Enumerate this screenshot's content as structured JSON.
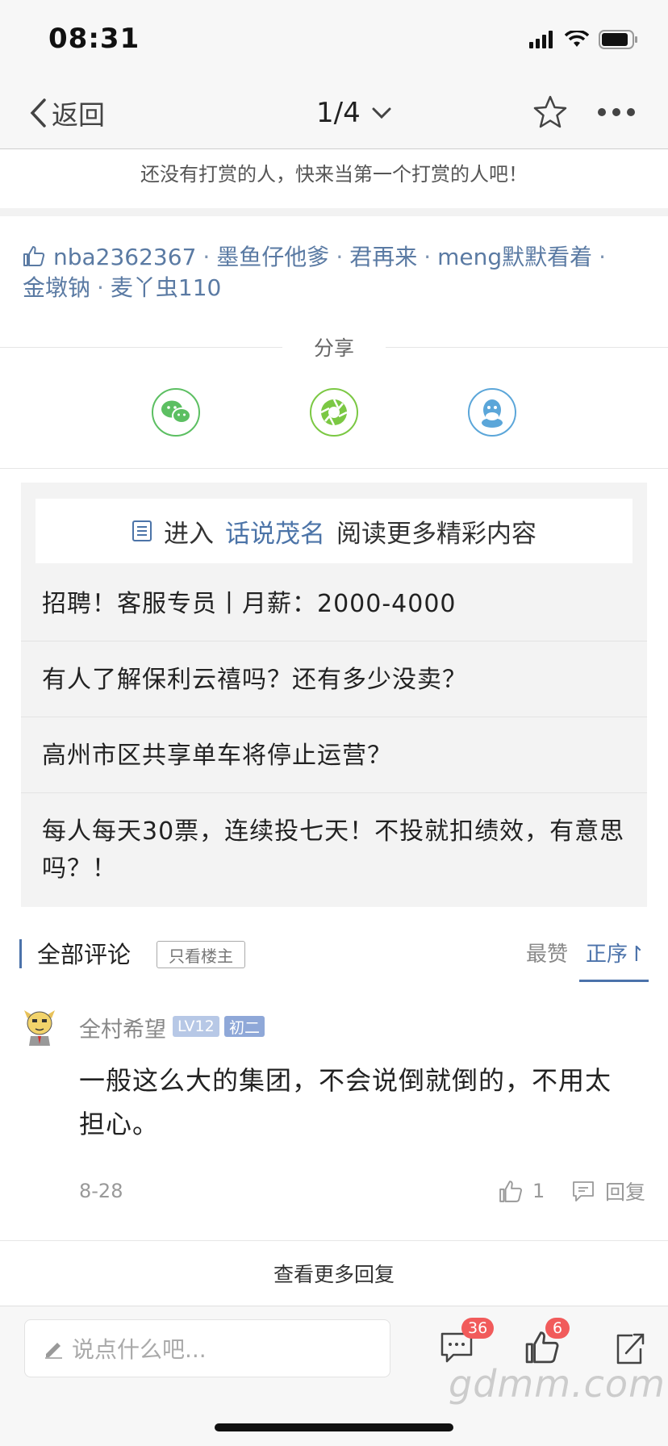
{
  "status_bar": {
    "time": "08:31"
  },
  "nav": {
    "back_label": "返回",
    "page_indicator": "1/4"
  },
  "reward": {
    "text": "还没有打赏的人，快来当第一个打赏的人吧！"
  },
  "likers": {
    "names": [
      "nba2362367",
      "墨鱼仔他爹",
      "君再来",
      "meng默默看着",
      "金墩钠",
      "麦丫虫110"
    ],
    "separator": "·"
  },
  "share": {
    "label": "分享",
    "icons": [
      "wechat-icon",
      "moments-icon",
      "qq-icon"
    ]
  },
  "forum": {
    "enter_prefix": "进入",
    "forum_name": "话说茂名",
    "enter_suffix": "阅读更多精彩内容",
    "threads": [
      {
        "title": "招聘！客服专员丨月薪：2000-4000"
      },
      {
        "title": "有人了解保利云禧吗？还有多少没卖？"
      },
      {
        "title": "高州市区共享单车将停止运营？"
      },
      {
        "title": "每人每天30票，连续投七天！不投就扣绩效，有意思吗？！"
      }
    ]
  },
  "comments_header": {
    "title": "全部评论",
    "only_op": "只看楼主",
    "sort_hot": "最赞",
    "sort_asc": "正序↾"
  },
  "comment": {
    "user": "全村希望",
    "level": "LV12",
    "grade": "初二",
    "text": "一般这么大的集团，不会说倒就倒的，不用太担心。",
    "date": "8-28",
    "likes": "1",
    "reply_label": "回复"
  },
  "more_replies": "查看更多回复",
  "bottom_bar": {
    "input_placeholder": "说点什么吧...",
    "comment_count": "36",
    "like_count": "6"
  },
  "watermark": "gdmm.com",
  "colors": {
    "link_blue": "#4b72aa",
    "badge_red": "#f15b5b",
    "wechat_green": "#5cbf62",
    "moments_green": "#7bc843",
    "qq_blue": "#5ba6d9"
  }
}
